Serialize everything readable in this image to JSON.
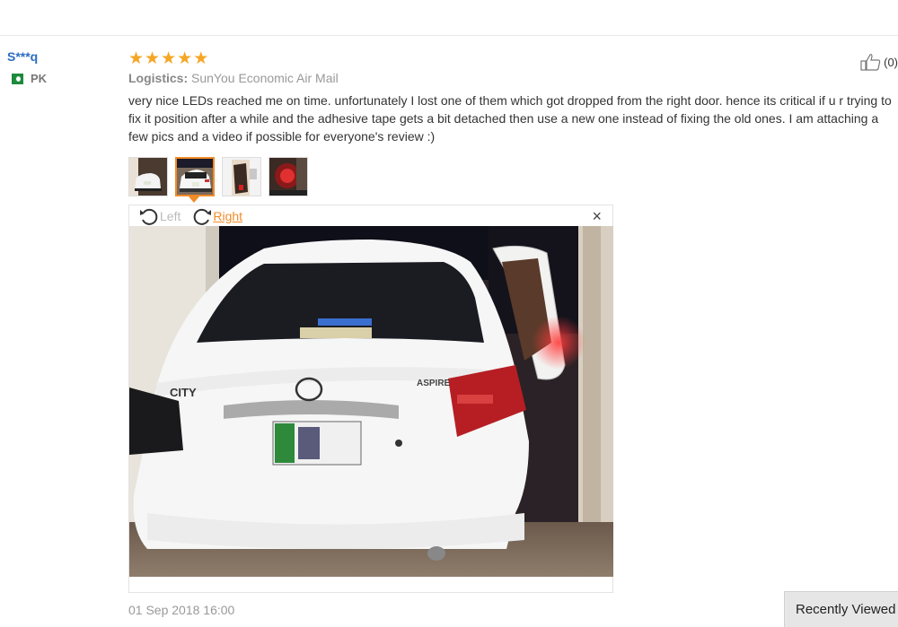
{
  "user": {
    "name": "S***q",
    "country_code": "PK",
    "flag_icon": "pakistan-flag-icon"
  },
  "review": {
    "rating": 5,
    "stars": [
      "★",
      "★",
      "★",
      "★",
      "★"
    ],
    "logistics_label": "Logistics:",
    "logistics_value": "SunYou Economic Air Mail",
    "text": "very nice LEDs reached me on time. unfortunately I lost one of them which got dropped from the right door. hence its critical if u r trying to fix it position after a while and the adhesive tape gets a bit detached then use a new one instead of fixing the old ones. I am attaching a few pics and a video if possible for everyone's review :)",
    "helpful_count": "(0)",
    "date": "01 Sep 2018 16:00"
  },
  "thumbnails": [
    {
      "name": "photo-thumbnail-1",
      "active": false
    },
    {
      "name": "photo-thumbnail-2",
      "active": true
    },
    {
      "name": "photo-thumbnail-3",
      "active": false
    },
    {
      "name": "photo-thumbnail-4",
      "active": false
    }
  ],
  "viewer": {
    "rotate_left": "Left",
    "rotate_right": "Right",
    "close": "×"
  },
  "recently_viewed": "Recently Viewed",
  "colors": {
    "accent": "#f28c28",
    "star": "#f5a623",
    "username": "#2b6cc4"
  }
}
